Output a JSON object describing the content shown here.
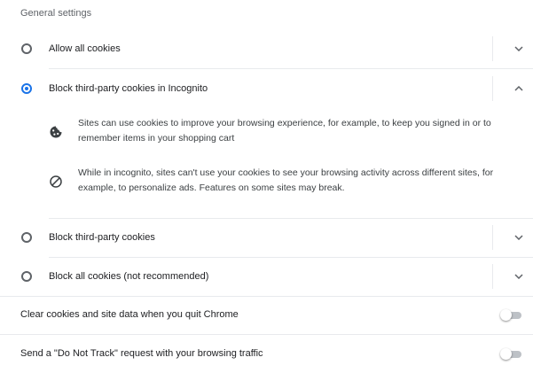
{
  "section_title": "General settings",
  "cookie_options": [
    {
      "label": "Allow all cookies",
      "selected": false,
      "expanded": false
    },
    {
      "label": "Block third-party cookies in Incognito",
      "selected": true,
      "expanded": true
    },
    {
      "label": "Block third-party cookies",
      "selected": false,
      "expanded": false
    },
    {
      "label": "Block all cookies (not recommended)",
      "selected": false,
      "expanded": false
    }
  ],
  "incognito_details": [
    {
      "icon": "cookie-icon",
      "text": "Sites can use cookies to improve your browsing experience, for example, to keep you signed in or to remember items in your shopping cart"
    },
    {
      "icon": "block-icon",
      "text": "While in incognito, sites can't use your cookies to see your browsing activity across different sites, for example, to personalize ads. Features on some sites may break."
    }
  ],
  "toggles": [
    {
      "label": "Clear cookies and site data when you quit Chrome",
      "on": false
    },
    {
      "label": "Send a \"Do Not Track\" request with your browsing traffic",
      "on": false
    }
  ],
  "colors": {
    "accent": "#1a73e8",
    "text": "#202124",
    "secondary_text": "#5f6368",
    "divider": "#e8eaed",
    "toggle_off_track": "#bdc1c6"
  }
}
